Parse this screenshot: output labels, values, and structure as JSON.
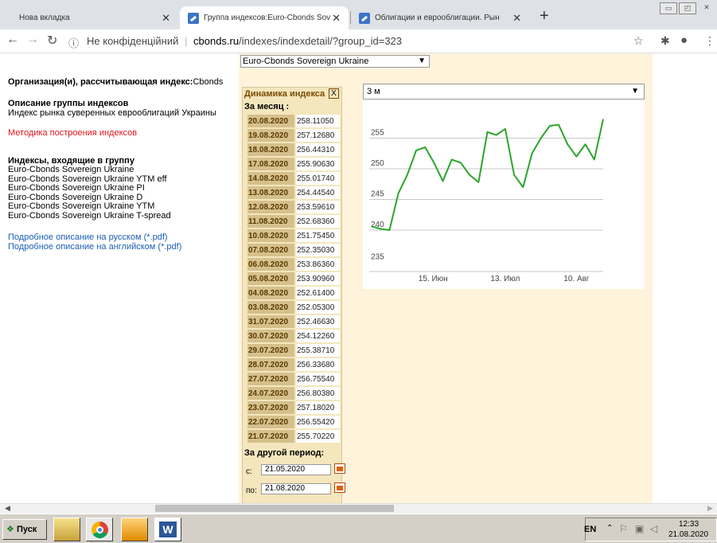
{
  "browser": {
    "tabs": [
      {
        "title": "Нова вкладка",
        "active": false
      },
      {
        "title": "Группа индексов:Euro-Cbonds Sov",
        "active": true
      },
      {
        "title": "Облигации и еврооблигации. Рын",
        "active": false
      }
    ],
    "new_tab": "+",
    "security_label": "Не конфіденційний",
    "url_domain": "cbonds.ru",
    "url_path": "/indexes/indexdetail/?group_id=323"
  },
  "left": {
    "org_label": "Организация(и), рассчитывающая индекс:",
    "org_value": "Cbonds",
    "desc_title": "Описание группы индексов",
    "desc_text": "Индекс рынка суверенных еврооблигаций Украины",
    "method_link": "Методика построения индексов",
    "indices_title": "Индексы, входящие в группу",
    "indices": [
      "Euro-Cbonds Sovereign Ukraine",
      "Euro-Cbonds Sovereign Ukraine YTM eff",
      "Euro-Cbonds Sovereign Ukraine PI",
      "Euro-Cbonds Sovereign Ukraine D",
      "Euro-Cbonds Sovereign Ukraine YTM",
      "Euro-Cbonds Sovereign Ukraine T-spread"
    ],
    "pdf_ru": "Подробное описание на русском (*.pdf)",
    "pdf_en": "Подробное описание на английском (*.pdf)"
  },
  "panel": {
    "group_select": "Euro-Cbonds Sovereign Ukraine",
    "dyn_title": "Динамика индекса",
    "dyn_close": "X",
    "month_label": "За месяц :",
    "rows": [
      [
        "20.08.2020",
        "258.11050"
      ],
      [
        "19.08.2020",
        "257.12680"
      ],
      [
        "18.08.2020",
        "256.44310"
      ],
      [
        "17.08.2020",
        "255.90630"
      ],
      [
        "14.08.2020",
        "255.01740"
      ],
      [
        "13.08.2020",
        "254.44540"
      ],
      [
        "12.08.2020",
        "253.59610"
      ],
      [
        "11.08.2020",
        "252.68360"
      ],
      [
        "10.08.2020",
        "251.75450"
      ],
      [
        "07.08.2020",
        "252.35030"
      ],
      [
        "06.08.2020",
        "253.86360"
      ],
      [
        "05.08.2020",
        "253.90960"
      ],
      [
        "04.08.2020",
        "252.61400"
      ],
      [
        "03.08.2020",
        "252.05300"
      ],
      [
        "31.07.2020",
        "252.46630"
      ],
      [
        "30.07.2020",
        "254.12260"
      ],
      [
        "29.07.2020",
        "255.38710"
      ],
      [
        "28.07.2020",
        "256.33680"
      ],
      [
        "27.07.2020",
        "256.75540"
      ],
      [
        "24.07.2020",
        "256.80380"
      ],
      [
        "23.07.2020",
        "257.18020"
      ],
      [
        "22.07.2020",
        "256.55420"
      ],
      [
        "21.07.2020",
        "255.70220"
      ]
    ],
    "other_period": "За другой период:",
    "from_label": "с:",
    "from_value": "21.05.2020",
    "to_label": "по:",
    "to_value": "21.08.2020",
    "period_select": "3 м"
  },
  "chart_data": {
    "type": "line",
    "x": [
      "21.05",
      "25.05",
      "28.05",
      "01.06",
      "04.06",
      "08.06",
      "11.06",
      "15.06",
      "18.06",
      "22.06",
      "25.06",
      "29.06",
      "02.07",
      "06.07",
      "09.07",
      "13.07",
      "16.07",
      "20.07",
      "23.07",
      "27.07",
      "30.07",
      "03.08",
      "06.08",
      "10.08",
      "13.08",
      "17.08",
      "20.08"
    ],
    "series": [
      {
        "values": [
          240.6,
          240.2,
          240.0,
          246,
          249,
          253,
          253.5,
          251,
          248,
          251.5,
          251,
          249,
          247.8,
          256,
          255.5,
          256.5,
          249,
          247,
          252.5,
          255,
          257,
          257.2,
          254,
          252,
          254,
          251.5,
          258.1
        ]
      }
    ],
    "yticks": [
      240,
      245,
      250,
      255
    ],
    "ylim": [
      233.5,
      260
    ],
    "xticks": [
      "15. Июн",
      "13. Июл",
      "10. Авг"
    ],
    "grid": true,
    "color": "#2aa52a"
  },
  "taskbar": {
    "start": "Пуск",
    "lang": "EN",
    "time": "12:33",
    "date": "21.08.2020"
  }
}
